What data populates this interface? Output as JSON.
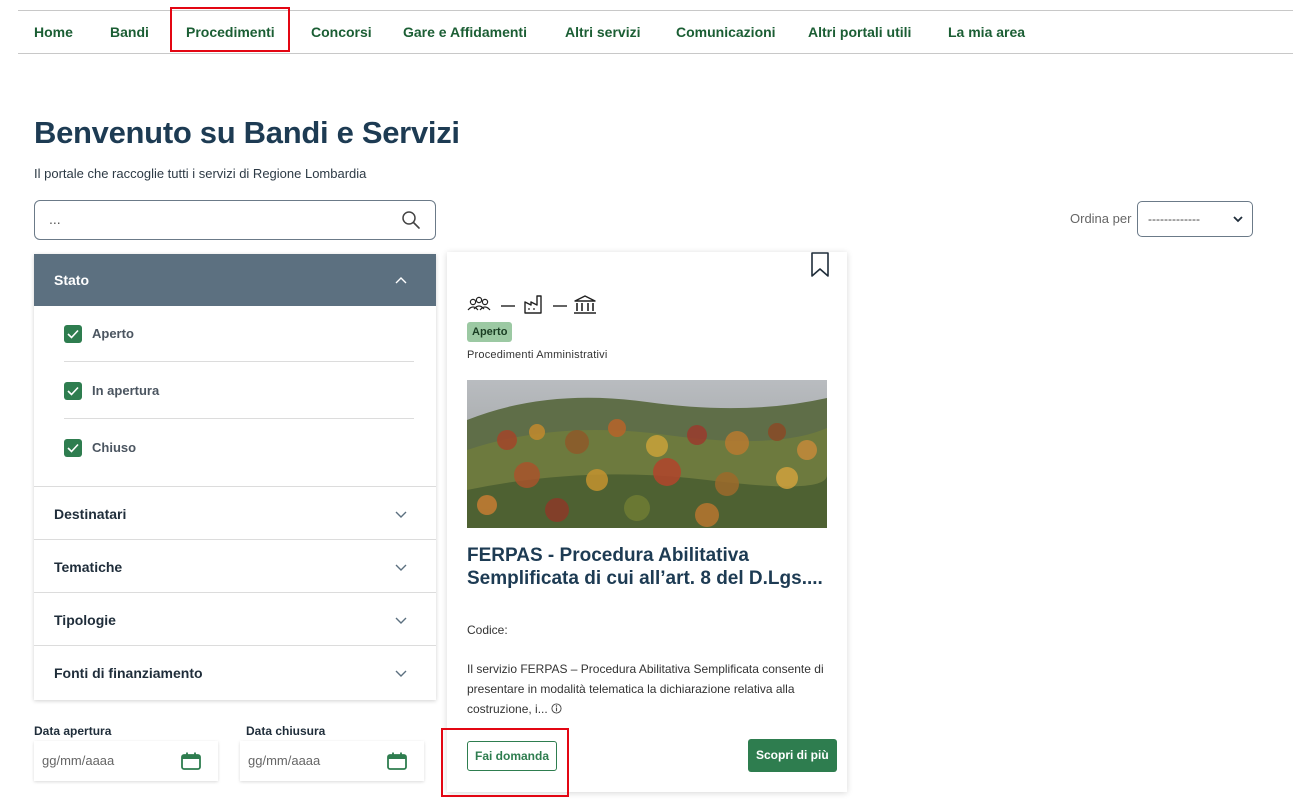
{
  "nav": {
    "items": [
      {
        "label": "Home"
      },
      {
        "label": "Bandi"
      },
      {
        "label": "Procedimenti"
      },
      {
        "label": "Concorsi"
      },
      {
        "label": "Gare e Affidamenti"
      },
      {
        "label": "Altri servizi"
      },
      {
        "label": "Comunicazioni"
      },
      {
        "label": "Altri portali utili"
      },
      {
        "label": "La mia area"
      }
    ],
    "highlighted": "Procedimenti"
  },
  "page": {
    "title": "Benvenuto su Bandi e Servizi",
    "subtitle": "Il portale che raccoglie tutti i servizi di Regione Lombardia"
  },
  "search": {
    "placeholder": "...",
    "icon": "search-icon"
  },
  "sort": {
    "label": "Ordina per",
    "selected": "-------------"
  },
  "filters": {
    "stato": {
      "label": "Stato",
      "options": [
        {
          "label": "Aperto",
          "checked": true
        },
        {
          "label": "In apertura",
          "checked": true
        },
        {
          "label": "Chiuso",
          "checked": true
        }
      ]
    },
    "sections": [
      {
        "label": "Destinatari"
      },
      {
        "label": "Tematiche"
      },
      {
        "label": "Tipologie"
      },
      {
        "label": "Fonti di finanziamento"
      }
    ]
  },
  "dates": {
    "apertura": {
      "label": "Data apertura",
      "placeholder": "gg/mm/aaaa"
    },
    "chiusura": {
      "label": "Data chiusura",
      "placeholder": "gg/mm/aaaa"
    }
  },
  "card": {
    "audience_icons": [
      "people-icon",
      "factory-icon",
      "institution-icon"
    ],
    "status": "Aperto",
    "type": "Procedimenti Amministrativi",
    "title": "FERPAS - Procedura Abilitativa Semplificata di cui all’art. 8 del D.Lgs....",
    "code_label": "Codice:",
    "description": "Il servizio FERPAS – Procedura Abilitativa Semplificata consente di presentare in modalità telematica la dichiarazione relativa alla costruzione, i...",
    "apply_label": "Fai domanda",
    "more_label": "Scopri di più"
  },
  "colors": {
    "brand_green": "#2e7d4f",
    "nav_green": "#1b5e34",
    "title_blue": "#1d3b53",
    "accordion_header": "#5c7080",
    "highlight_red": "#e30613",
    "badge_green": "#9cc9a3"
  }
}
